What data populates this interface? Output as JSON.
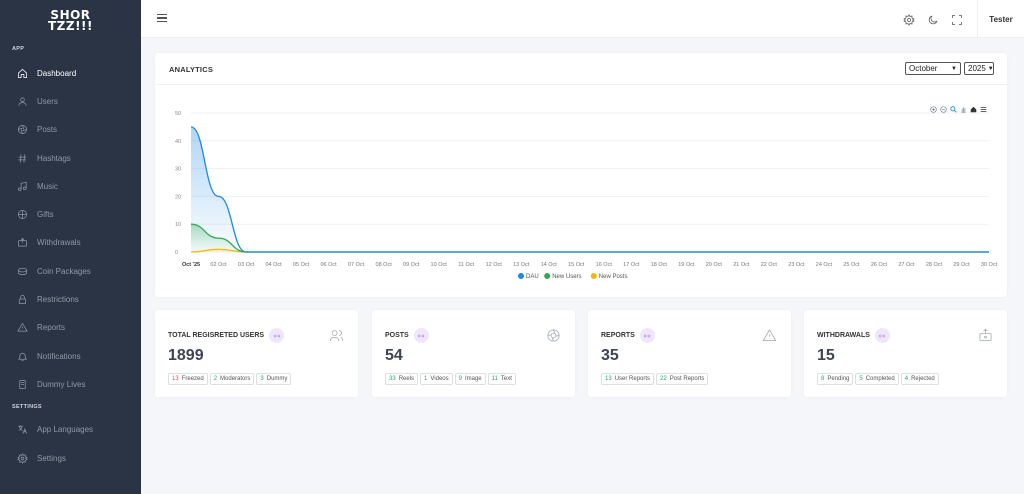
{
  "logo": {
    "line1": "SHOR",
    "line2": "TZZ!!!"
  },
  "sidebar": {
    "section_app": "APP",
    "section_settings": "SETTINGS",
    "items": [
      {
        "label": "Dashboard",
        "icon": "home-icon",
        "active": true
      },
      {
        "label": "Users",
        "icon": "user-icon"
      },
      {
        "label": "Posts",
        "icon": "aperture-icon"
      },
      {
        "label": "Hashtags",
        "icon": "hash-icon"
      },
      {
        "label": "Music",
        "icon": "music-icon"
      },
      {
        "label": "Gifts",
        "icon": "gift-icon"
      },
      {
        "label": "Withdrawals",
        "icon": "withdraw-icon"
      },
      {
        "label": "Coin Packages",
        "icon": "coins-icon"
      },
      {
        "label": "Restrictions",
        "icon": "lock-icon"
      },
      {
        "label": "Reports",
        "icon": "alert-triangle-icon"
      },
      {
        "label": "Notifications",
        "icon": "bell-icon"
      },
      {
        "label": "Dummy Lives",
        "icon": "device-icon"
      }
    ],
    "settings_items": [
      {
        "label": "App Languages",
        "icon": "language-icon"
      },
      {
        "label": "Settings",
        "icon": "gear-icon"
      }
    ]
  },
  "topbar": {
    "user": "Tester",
    "icons": [
      "gear-icon",
      "moon-icon",
      "fullscreen-icon"
    ]
  },
  "analytics": {
    "title": "ANALYTICS",
    "month": "October",
    "year": "2025"
  },
  "chart_data": {
    "type": "area",
    "title": "",
    "xlabel": "",
    "ylabel": "",
    "ylim": [
      0,
      50
    ],
    "yticks": [
      0,
      10,
      20,
      30,
      40,
      50
    ],
    "categories": [
      "Oct '25",
      "02 Oct",
      "03 Oct",
      "04 Oct",
      "05 Oct",
      "06 Oct",
      "07 Oct",
      "08 Oct",
      "09 Oct",
      "10 Oct",
      "11 Oct",
      "12 Oct",
      "13 Oct",
      "14 Oct",
      "15 Oct",
      "16 Oct",
      "17 Oct",
      "18 Oct",
      "19 Oct",
      "20 Oct",
      "21 Oct",
      "22 Oct",
      "23 Oct",
      "24 Oct",
      "25 Oct",
      "26 Oct",
      "27 Oct",
      "28 Oct",
      "29 Oct",
      "30 Oct"
    ],
    "series": [
      {
        "name": "DAU",
        "color": "#1e88e5",
        "values": [
          45,
          20,
          0,
          0,
          0,
          0,
          0,
          0,
          0,
          0,
          0,
          0,
          0,
          0,
          0,
          0,
          0,
          0,
          0,
          0,
          0,
          0,
          0,
          0,
          0,
          0,
          0,
          0,
          0,
          0,
          0
        ]
      },
      {
        "name": "New Users",
        "color": "#2eaa4e",
        "values": [
          10,
          5,
          0,
          0,
          0,
          0,
          0,
          0,
          0,
          0,
          0,
          0,
          0,
          0,
          0,
          0,
          0,
          0,
          0,
          0,
          0,
          0,
          0,
          0,
          0,
          0,
          0,
          0,
          0,
          0,
          0
        ]
      },
      {
        "name": "New Posts",
        "color": "#f5b800",
        "values": [
          0,
          1,
          0,
          0,
          0,
          0,
          0,
          0,
          0,
          0,
          0,
          0,
          0,
          0,
          0,
          0,
          0,
          0,
          0,
          0,
          0,
          0,
          0,
          0,
          0,
          0,
          0,
          0,
          0,
          0,
          0
        ]
      }
    ],
    "legend": "bottom-center",
    "grid": true
  },
  "stats": [
    {
      "title": "TOTAL REGISRETED USERS",
      "value": "1899",
      "icon": "users-icon",
      "chips": [
        {
          "n": "13",
          "label": "Freezed",
          "color": "red"
        },
        {
          "n": "2",
          "label": "Moderators",
          "color": "green"
        },
        {
          "n": "3",
          "label": "Dummy",
          "color": "green"
        }
      ]
    },
    {
      "title": "POSTS",
      "value": "54",
      "icon": "aperture-icon",
      "chips": [
        {
          "n": "33",
          "label": "Reels",
          "color": "green"
        },
        {
          "n": "1",
          "label": "Videos",
          "color": "green"
        },
        {
          "n": "9",
          "label": "Image",
          "color": "green"
        },
        {
          "n": "11",
          "label": "Text",
          "color": "green"
        }
      ]
    },
    {
      "title": "REPORTS",
      "value": "35",
      "icon": "alert-triangle-icon",
      "chips": [
        {
          "n": "13",
          "label": "User Reports",
          "color": "green"
        },
        {
          "n": "22",
          "label": "Post Reports",
          "color": "green"
        }
      ]
    },
    {
      "title": "WITHDRAWALS",
      "value": "15",
      "icon": "withdraw-icon",
      "chips": [
        {
          "n": "8",
          "label": "Pending",
          "color": "green"
        },
        {
          "n": "5",
          "label": "Completed",
          "color": "green"
        },
        {
          "n": "4",
          "label": "Rejected",
          "color": "green"
        }
      ]
    }
  ]
}
